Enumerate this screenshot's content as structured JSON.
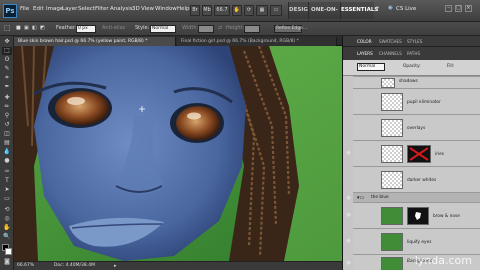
{
  "app": {
    "logo": "Ps"
  },
  "menu": [
    "File",
    "Edit",
    "Image",
    "Layer",
    "Select",
    "Filter",
    "Analysis",
    "3D",
    "View",
    "Window",
    "Help"
  ],
  "menubar_right": {
    "zoom": "66.7",
    "workspace_design": "DESIGN",
    "workspace_one": "ONE-ON-ONE",
    "workspace_essentials": "ESSENTIALS",
    "more": "»",
    "cs_live": "CS Live"
  },
  "options": {
    "feather_label": "Feather:",
    "feather_value": "0 px",
    "anti_alias": "Anti-alias",
    "style_label": "Style:",
    "style_value": "Normal",
    "width_label": "Width:",
    "height_label": "Height:",
    "refine": "Refine Edge..."
  },
  "tabs": [
    {
      "label": "Blue skin brown hair.psd @ 66.7% (yellow paint, RGB/8) *",
      "close": "×"
    },
    {
      "label": "Final fiction girl.psd @ 66.7% (Background, RGB/8) *",
      "close": "×"
    }
  ],
  "status": {
    "zoom": "66.67%",
    "doc": "Doc: 4.40M/38.4M"
  },
  "panels": {
    "top_tabs": [
      "COLOR",
      "SWATCHES",
      "STYLES"
    ],
    "layer_tabs": [
      "LAYERS",
      "CHANNELS",
      "PATHS"
    ],
    "blend": "Normal",
    "opacity_label": "Opacity:",
    "fill_label": "Fill:",
    "layers": [
      {
        "name": "shadows"
      },
      {
        "name": "pupil eliminator"
      },
      {
        "name": "overlays"
      },
      {
        "name": "iries"
      },
      {
        "name": "darker whites"
      },
      {
        "name": "the blue"
      },
      {
        "name": "brow & nose"
      },
      {
        "name": "liquify eyes"
      },
      {
        "name": "Background"
      }
    ]
  },
  "watermark": "lynda.com",
  "colors": {
    "skin": "#4d6aa0",
    "hair": "#3a2618",
    "grass": "#4f9a3a",
    "iris": "#8a4a22"
  }
}
